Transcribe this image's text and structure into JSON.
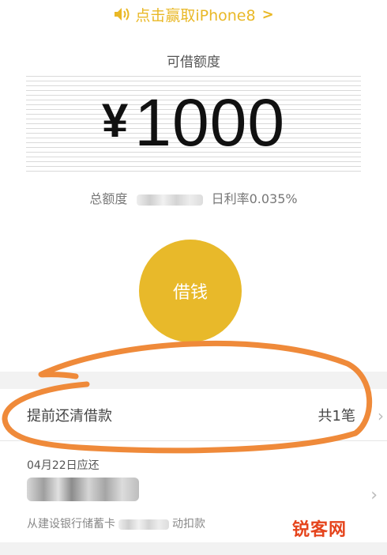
{
  "promo": {
    "icon": "speaker-icon",
    "text": "点击赢取iPhone8",
    "chevron": ">"
  },
  "credit": {
    "label": "可借额度",
    "currency": "¥",
    "amount": "1000",
    "total_label": "总额度",
    "rate_label": "日利率0.035%"
  },
  "borrow_button": {
    "label": "借钱"
  },
  "prepay": {
    "label": "提前还清借款",
    "count": "共1笔",
    "chevron": "›"
  },
  "due": {
    "date": "04月22日应还",
    "desc_prefix": "从建设银行储蓄卡",
    "desc_suffix": "动扣款",
    "chevron": "›"
  },
  "watermark": "锐客网",
  "colors": {
    "accent": "#e8b92a",
    "promo_text": "#e9b826",
    "annotation": "#ef8a3a",
    "watermark": "#e5441c"
  }
}
